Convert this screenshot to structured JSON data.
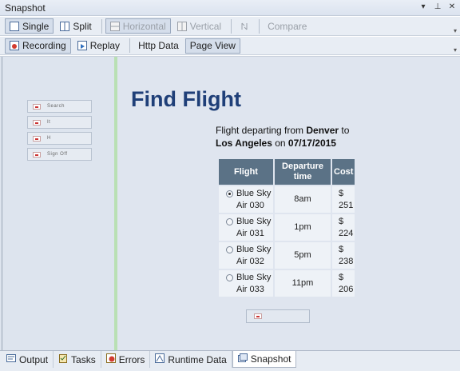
{
  "window": {
    "title": "Snapshot"
  },
  "toolbar1": {
    "single": "Single",
    "split": "Split",
    "horizontal": "Horizontal",
    "vertical": "Vertical",
    "compare": "Compare"
  },
  "toolbar2": {
    "recording": "Recording",
    "replay": "Replay",
    "http_data": "Http Data",
    "page_view": "Page View"
  },
  "left_nav": {
    "items": [
      {
        "label": "Search"
      },
      {
        "label": "It"
      },
      {
        "label": "H"
      },
      {
        "label": "Sign Off"
      }
    ]
  },
  "page": {
    "heading": "Find Flight",
    "info_prefix": "Flight departing from ",
    "from": "Denver",
    "info_to": " to",
    "to": "Los Angeles",
    "info_on": " on ",
    "date": "07/17/2015",
    "columns": {
      "flight": "Flight",
      "departure": "Departure time",
      "cost": "Cost"
    },
    "flights": [
      {
        "name": "Blue Sky Air 030",
        "time": "8am",
        "cost": "$ 251",
        "selected": true
      },
      {
        "name": "Blue Sky Air 031",
        "time": "1pm",
        "cost": "$ 224",
        "selected": false
      },
      {
        "name": "Blue Sky Air 032",
        "time": "5pm",
        "cost": "$ 238",
        "selected": false
      },
      {
        "name": "Blue Sky Air 033",
        "time": "11pm",
        "cost": "$ 206",
        "selected": false
      }
    ]
  },
  "bottom_tabs": {
    "output": "Output",
    "tasks": "Tasks",
    "errors": "Errors",
    "runtime": "Runtime Data",
    "snapshot": "Snapshot"
  }
}
